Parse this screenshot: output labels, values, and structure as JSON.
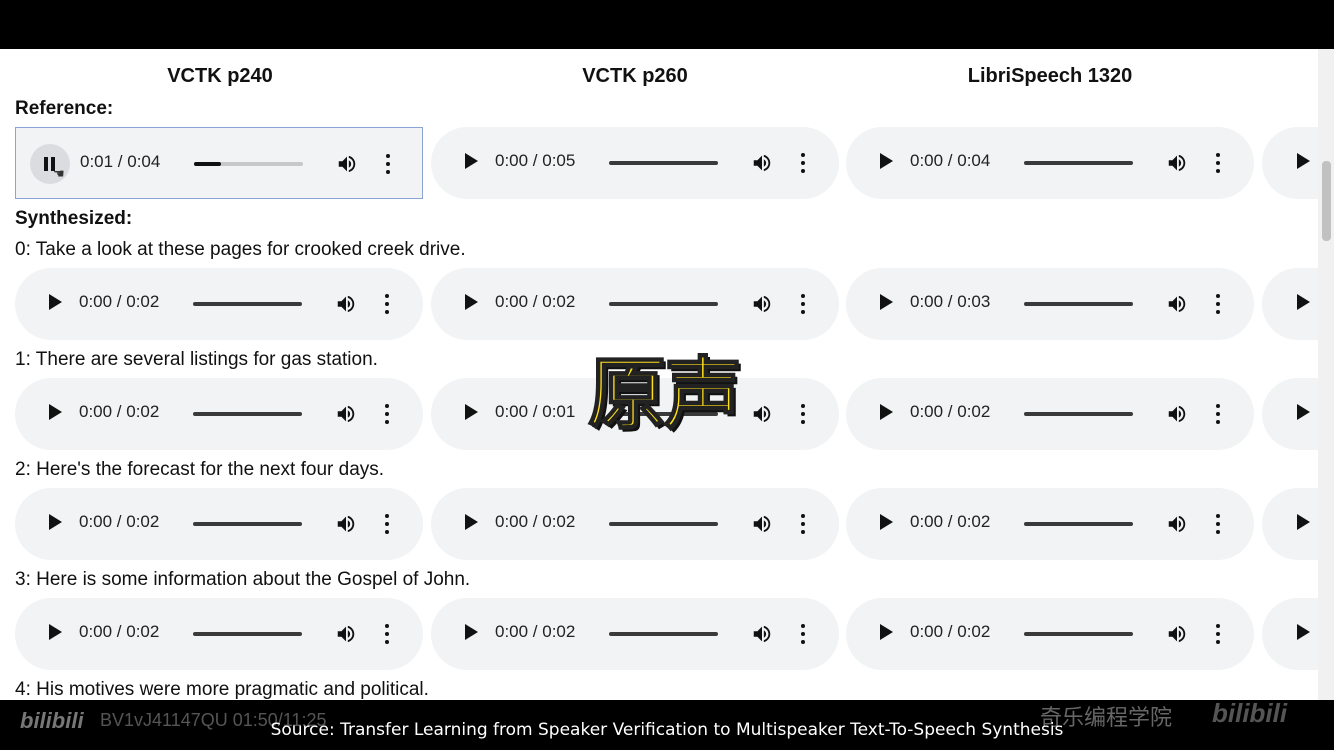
{
  "columns": [
    "VCTK p240",
    "VCTK p260",
    "LibriSpeech 1320"
  ],
  "reference_label": "Reference:",
  "synthesized_label": "Synthesized:",
  "reference_players": [
    {
      "time": "0:01 / 0:04",
      "state": "playing",
      "progress": 0.25
    },
    {
      "time": "0:00 / 0:05",
      "state": "paused",
      "progress": 0
    },
    {
      "time": "0:00 / 0:04",
      "state": "paused",
      "progress": 0
    }
  ],
  "sentences": [
    {
      "text": "0: Take a look at these pages for crooked creek drive.",
      "times": [
        "0:00 / 0:02",
        "0:00 / 0:02",
        "0:00 / 0:03"
      ]
    },
    {
      "text": "1: There are several listings for gas station.",
      "times": [
        "0:00 / 0:02",
        "0:00 / 0:01",
        "0:00 / 0:02"
      ]
    },
    {
      "text": "2: Here's the forecast for the next four days.",
      "times": [
        "0:00 / 0:02",
        "0:00 / 0:02",
        "0:00 / 0:02"
      ]
    },
    {
      "text": "3: Here is some information about the Gospel of John.",
      "times": [
        "0:00 / 0:02",
        "0:00 / 0:02",
        "0:00 / 0:02"
      ]
    },
    {
      "text": "4: His motives were more pragmatic and political."
    }
  ],
  "overlay_text": "原声",
  "watermark": {
    "logo": "bilibili",
    "video_id": "BV1vJ41147QU 01:50/11:25",
    "channel": "奇乐编程学院",
    "logo2": "bilibili"
  },
  "source_caption": "Source: Transfer Learning from Speaker Verification to Multispeaker Text-To-Speech Synthesis",
  "icons": {
    "play": "play-icon",
    "pause": "pause-icon",
    "volume": "volume-icon",
    "more": "more-options-icon"
  }
}
